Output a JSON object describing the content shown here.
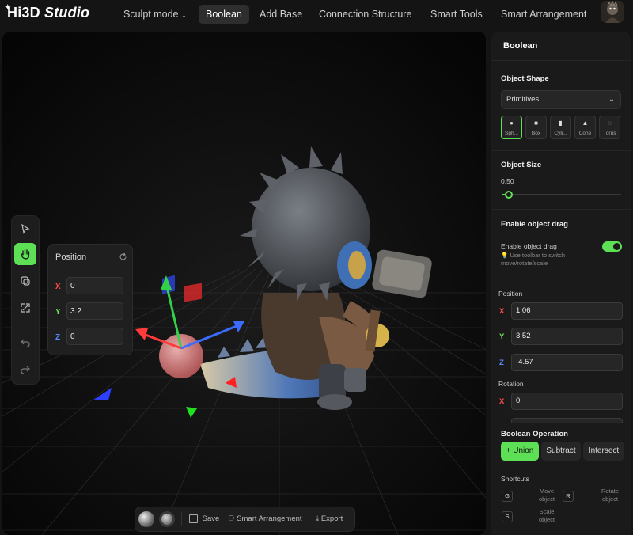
{
  "app": {
    "logo_main": "Hi3D",
    "logo_sub": "Studio"
  },
  "nav": {
    "sculpt": "Sculpt mode",
    "boolean": "Boolean",
    "add_base": "Add Base",
    "connection": "Connection Structure",
    "smart_tools": "Smart Tools",
    "smart_arrangement": "Smart Arrangement"
  },
  "popover": {
    "title": "Position",
    "x_label": "X",
    "x_value": "0",
    "y_label": "Y",
    "y_value": "3.2",
    "z_label": "Z",
    "z_value": "0"
  },
  "bottombar": {
    "save": "Save",
    "smart_arrangement": "Smart Arrangement",
    "export": "Export"
  },
  "panel": {
    "header": "Boolean",
    "object_shape": {
      "title": "Object Shape",
      "dropdown_value": "Primitives",
      "shapes": [
        {
          "label": "Sph...",
          "icon": "sphere-icon"
        },
        {
          "label": "Box",
          "icon": "box-icon"
        },
        {
          "label": "Cyli...",
          "icon": "cylinder-icon"
        },
        {
          "label": "Cone",
          "icon": "cone-icon"
        },
        {
          "label": "Torus",
          "icon": "torus-icon"
        }
      ]
    },
    "object_size": {
      "title": "Object Size",
      "value": "0.50",
      "fraction": 0.06
    },
    "drag": {
      "title": "Enable object drag",
      "label": "Enable object drag",
      "hint": "Use toolbar to switch move/rotate/scale",
      "enabled": true
    },
    "position": {
      "title": "Position",
      "x_label": "X",
      "x": "1.06",
      "y_label": "Y",
      "y": "3.52",
      "z_label": "Z",
      "z": "-4.57"
    },
    "rotation": {
      "title": "Rotation",
      "x_label": "X",
      "x": "0"
    },
    "boolean_operation": {
      "title": "Boolean Operation",
      "union": "Union",
      "subtract": "Subtract",
      "intersect": "Intersect"
    },
    "shortcuts": {
      "title": "Shortcuts",
      "items": [
        {
          "key": "G",
          "label": "Move object"
        },
        {
          "key": "R",
          "label": "Rotate object"
        },
        {
          "key": "S",
          "label": "Scale object"
        }
      ]
    }
  },
  "colors": {
    "accent": "#5ee056",
    "axis_x": "#ff3b3b",
    "axis_y": "#35d04a",
    "axis_z": "#3b6bff",
    "background": "#141414"
  }
}
